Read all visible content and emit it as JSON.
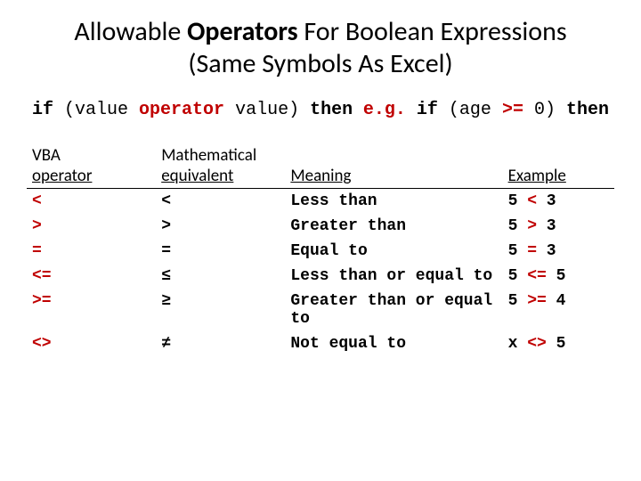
{
  "title": {
    "pre": "Allowable ",
    "bold": "Operators",
    "post1": " For Boolean Expressions",
    "line2": "(Same Symbols As Excel)"
  },
  "syntax": {
    "if": "if",
    "lparen": "(value ",
    "operator": "operator",
    "rhs_val": " value)",
    "then": "then",
    "eg_prefix": "e.g.",
    "eg_if": "if",
    "eg_lparen": "(age ",
    "eg_op": ">=",
    "eg_rhs": " 0)",
    "eg_then": "then"
  },
  "headers": {
    "vba_top": "VBA",
    "vba": "operator",
    "math_top": "Mathematical",
    "math": "equivalent",
    "meaning": "Meaning",
    "example": "Example"
  },
  "rows": [
    {
      "vba": "<",
      "math": "<",
      "meaning": "Less than",
      "ex_l": "5 ",
      "ex_op": "<",
      "ex_r": " 3"
    },
    {
      "vba": ">",
      "math": ">",
      "meaning": "Greater than",
      "ex_l": "5 ",
      "ex_op": ">",
      "ex_r": " 3"
    },
    {
      "vba": "=",
      "math": "=",
      "meaning": "Equal to",
      "ex_l": "5 ",
      "ex_op": "=",
      "ex_r": " 3"
    },
    {
      "vba": "<=",
      "math": "≤",
      "meaning": "Less than or equal to",
      "ex_l": "5 ",
      "ex_op": "<=",
      "ex_r": " 5"
    },
    {
      "vba": ">=",
      "math": "≥",
      "meaning": "Greater than or equal to",
      "ex_l": "5 ",
      "ex_op": ">=",
      "ex_r": " 4"
    },
    {
      "vba": "<>",
      "math": "≠",
      "meaning": "Not equal to",
      "ex_l": "x ",
      "ex_op": "<>",
      "ex_r": " 5"
    }
  ]
}
